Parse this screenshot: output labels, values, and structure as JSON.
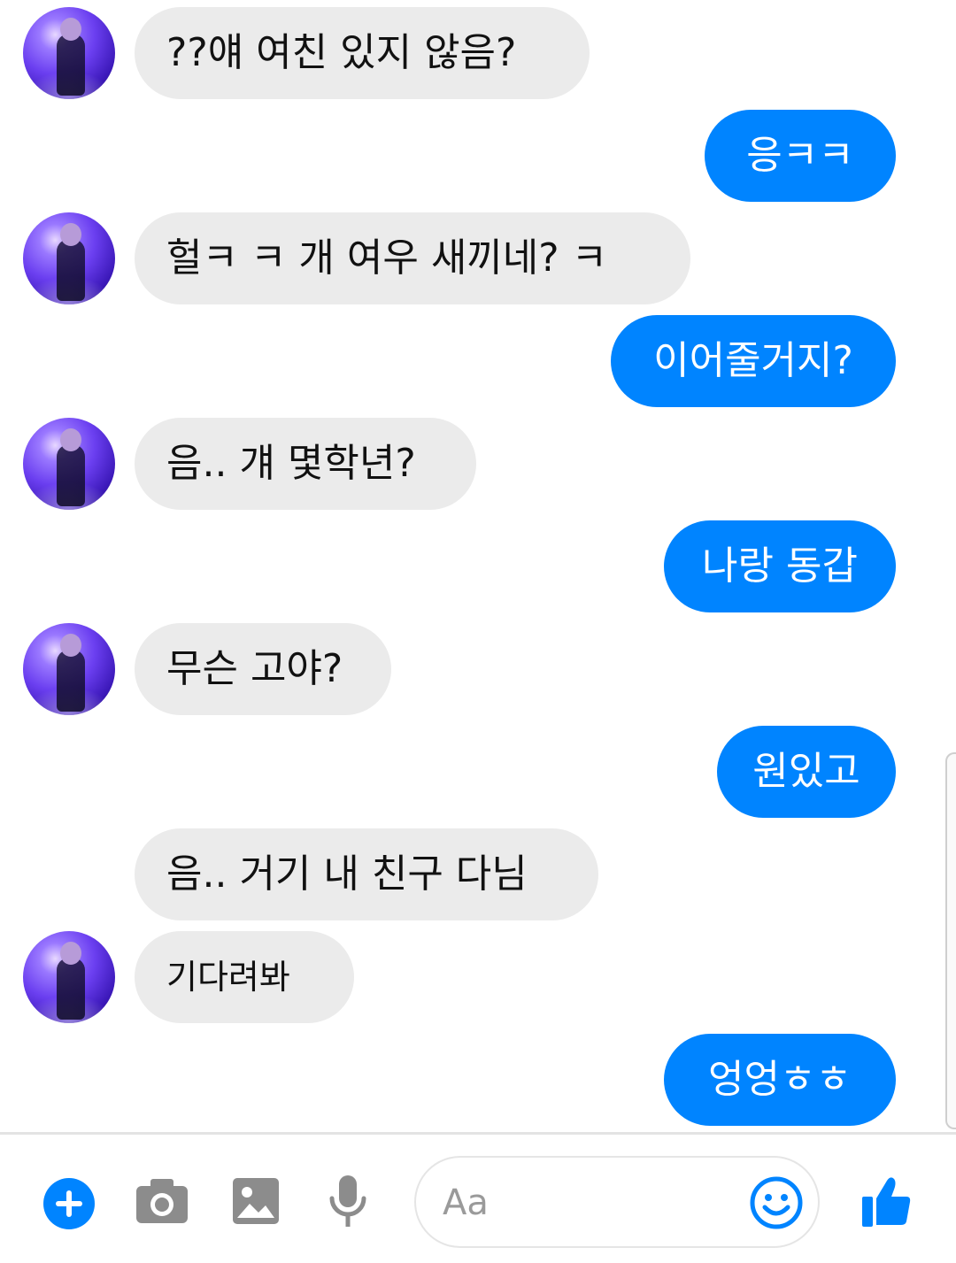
{
  "app": {
    "accent_color": "#0084ff",
    "incoming_bubble_color": "#ebebeb",
    "outgoing_bubble_color": "#0084ff"
  },
  "messages": [
    {
      "side": "incoming",
      "text": "??얘 여친 있지 않음?",
      "has_avatar": true
    },
    {
      "side": "outgoing",
      "text": "응ㅋㅋ"
    },
    {
      "side": "incoming",
      "text": "헐ㅋ ㅋ 개 여우 새끼네? ㅋ",
      "has_avatar": true
    },
    {
      "side": "outgoing",
      "text": "이어줄거지?"
    },
    {
      "side": "incoming",
      "text": "음.. 걔 몇학년?",
      "has_avatar": true
    },
    {
      "side": "outgoing",
      "text": "나랑 동갑"
    },
    {
      "side": "incoming",
      "text": "무슨 고야?",
      "has_avatar": true
    },
    {
      "side": "outgoing",
      "text": "원있고"
    },
    {
      "side": "incoming",
      "text": "음.. 거기 내 친구 다님",
      "has_avatar": false
    },
    {
      "side": "incoming",
      "text": "기다려봐",
      "has_avatar": true
    },
    {
      "side": "outgoing",
      "text": "엉엉ㅎㅎ"
    }
  ],
  "composer": {
    "placeholder": "Aa",
    "icons": {
      "add": "plus-circle-icon",
      "camera": "camera-icon",
      "gallery": "image-icon",
      "voice": "microphone-icon",
      "emoji": "smiley-icon",
      "like": "thumbs-up-icon"
    }
  }
}
